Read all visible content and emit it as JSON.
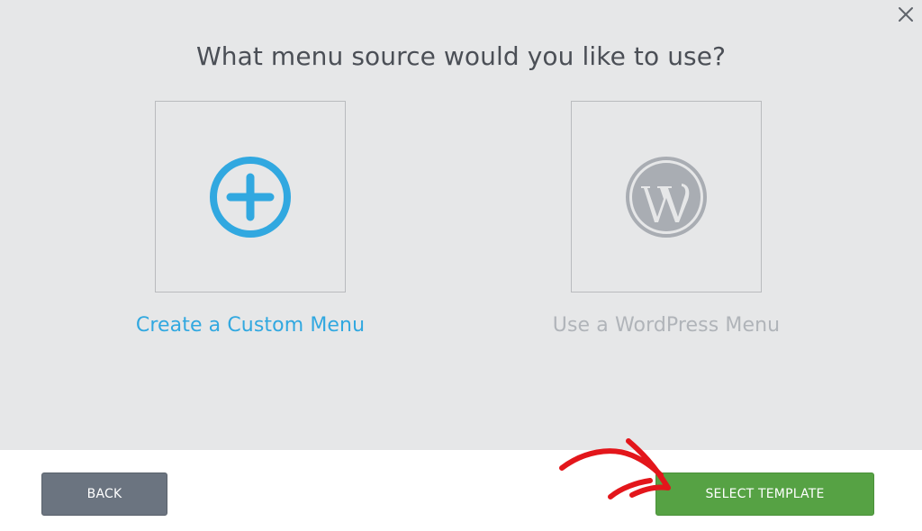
{
  "dialog": {
    "title": "What menu source would you like to use?",
    "close_icon": "close-icon"
  },
  "options": [
    {
      "label": "Create a Custom Menu",
      "icon": "plus-circle-icon",
      "color": "#31a8e0",
      "state": "active"
    },
    {
      "label": "Use a WordPress Menu",
      "icon": "wordpress-logo-icon",
      "color": "#b0b4b9",
      "state": "inactive"
    }
  ],
  "footer": {
    "back_label": "BACK",
    "select_label": "SELECT TEMPLATE"
  },
  "colors": {
    "accent": "#31a8e0",
    "primary_button": "#56a244",
    "secondary_button": "#6b7480",
    "annotation_arrow": "#e3161b"
  }
}
